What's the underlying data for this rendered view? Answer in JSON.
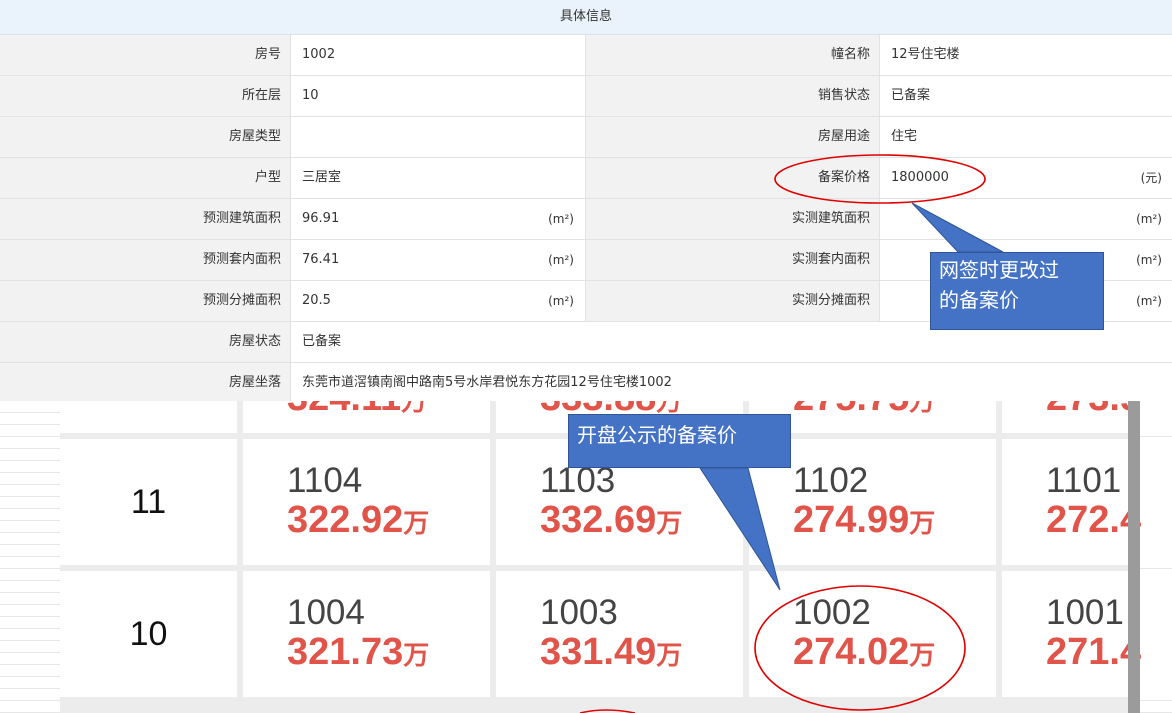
{
  "info": {
    "title": "具体信息",
    "rows": [
      {
        "l1": "房号",
        "v1": "1002",
        "u1": "",
        "l2": "幢名称",
        "v2": "12号住宅楼",
        "u2": ""
      },
      {
        "l1": "所在层",
        "v1": "10",
        "u1": "",
        "l2": "销售状态",
        "v2": "已备案",
        "u2": ""
      },
      {
        "l1": "房屋类型",
        "v1": "",
        "u1": "",
        "l2": "房屋用途",
        "v2": "住宅",
        "u2": ""
      },
      {
        "l1": "户型",
        "v1": "三居室",
        "u1": "",
        "l2": "备案价格",
        "v2": "1800000",
        "u2": "(元)"
      },
      {
        "l1": "预测建筑面积",
        "v1": "96.91",
        "u1": "(m²)",
        "l2": "实测建筑面积",
        "v2": "",
        "u2": "(m²)"
      },
      {
        "l1": "预测套内面积",
        "v1": "76.41",
        "u1": "(m²)",
        "l2": "实测套内面积",
        "v2": "",
        "u2": "(m²)"
      },
      {
        "l1": "预测分摊面积",
        "v1": "20.5",
        "u1": "(m²)",
        "l2": "实测分摊面积",
        "v2": "",
        "u2": "(m²)"
      }
    ],
    "status_label": "房屋状态",
    "status_value": "已备案",
    "address_label": "房屋坐落",
    "address_value": "东莞市道滘镇南阁中路南5号水岸君悦东方花园12号住宅楼1002"
  },
  "grid": {
    "wan": "万",
    "floors": [
      {
        "floor": "11",
        "units": [
          {
            "no": "1104",
            "price": "322.92"
          },
          {
            "no": "1103",
            "price": "332.69"
          },
          {
            "no": "1102",
            "price": "274.99"
          },
          {
            "no": "1101",
            "price": "272.4"
          }
        ]
      },
      {
        "floor": "10",
        "units": [
          {
            "no": "1004",
            "price": "321.73"
          },
          {
            "no": "1003",
            "price": "331.49"
          },
          {
            "no": "1002",
            "price": "274.02"
          },
          {
            "no": "1001",
            "price": "271.4"
          }
        ]
      }
    ]
  },
  "annotations": {
    "callout_top": [
      "网签时更改过",
      "的备案价"
    ],
    "callout_bottom": "开盘公示的备案价",
    "highlight_color": "#e00000",
    "callout_color": "#4472c4"
  }
}
